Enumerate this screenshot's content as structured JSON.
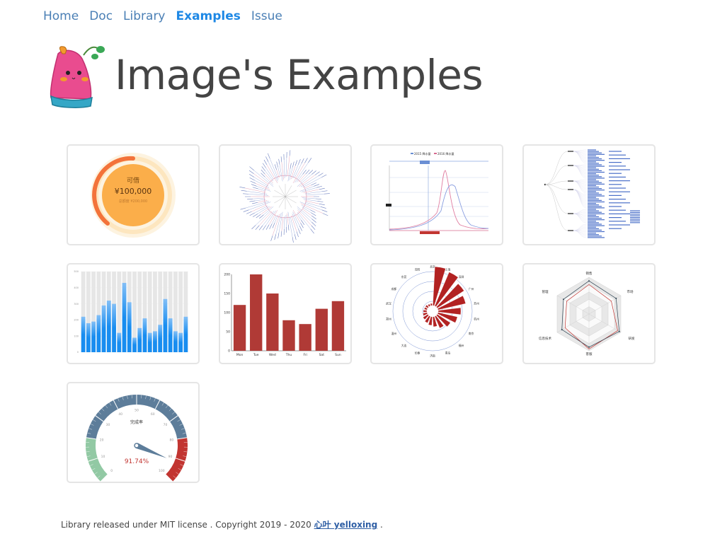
{
  "nav": {
    "items": [
      "Home",
      "Doc",
      "Library",
      "Examples",
      "Issue"
    ],
    "active": "Examples"
  },
  "header": {
    "title": "Image's Examples"
  },
  "cards": [
    {
      "name": "ring-progress",
      "label_top": "可借",
      "amount": "¥100,000",
      "sub": "总额度 ¥200,000"
    },
    {
      "name": "radial-tree"
    },
    {
      "name": "line-comparison",
      "legend": [
        "2015 降水量",
        "2016 降水量"
      ]
    },
    {
      "name": "tree-diagram"
    },
    {
      "name": "gradient-bar"
    },
    {
      "name": "bar-weekly"
    },
    {
      "name": "polar-bar"
    },
    {
      "name": "radar"
    },
    {
      "name": "gauge",
      "title": "完成率",
      "value_text": "91.74%"
    }
  ],
  "chart_bar_weekly": {
    "type": "bar",
    "categories": [
      "Mon",
      "Tue",
      "Wed",
      "Thu",
      "Fri",
      "Sat",
      "Sun"
    ],
    "values": [
      120,
      200,
      150,
      80,
      70,
      110,
      130
    ],
    "ylim": [
      0,
      200
    ],
    "yticks": [
      "0",
      "50",
      "100",
      "150",
      "200"
    ],
    "color": "#b03a36"
  },
  "chart_gradient_bar": {
    "values": [
      220,
      180,
      190,
      230,
      290,
      320,
      300,
      120,
      430,
      310,
      90,
      150,
      210,
      120,
      130,
      170,
      330,
      210,
      130,
      120,
      220
    ],
    "ylim": [
      0,
      500
    ],
    "yticks": [
      "0",
      "100",
      "200",
      "300",
      "400",
      "500"
    ]
  },
  "gauge": {
    "ticks": [
      "0",
      "10",
      "20",
      "30",
      "40",
      "50",
      "60",
      "70",
      "80",
      "90",
      "100"
    ],
    "value": 91.74
  },
  "radar": {
    "axes": [
      "销售",
      "管理",
      "信息技术",
      "客服",
      "研发",
      "市场"
    ]
  },
  "polar": {
    "labels": [
      "北京",
      "上海",
      "深圳",
      "广州",
      "苏州",
      "杭州",
      "南京",
      "福州",
      "青岛",
      "济南",
      "长春",
      "大连",
      "温州",
      "郑州",
      "武汉",
      "成都",
      "东莞",
      "沈阳"
    ]
  },
  "footer": {
    "text": "Library released under MIT license . Copyright 2019 - 2020 ",
    "link": "心叶 yelloxing",
    "end": " ."
  },
  "colors": {
    "accent": "#1e88e5",
    "nav": "#4a7fb5",
    "bar_red": "#b03a36",
    "gauge_blue": "#5d7d9a",
    "gauge_green": "#92c9a4",
    "gauge_red": "#c23531"
  }
}
